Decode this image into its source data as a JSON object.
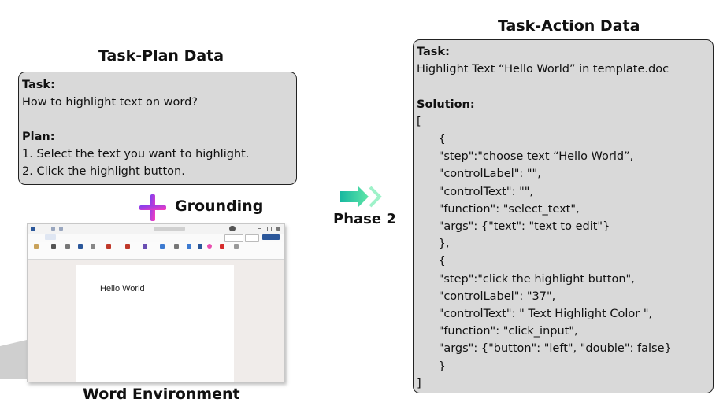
{
  "task_plan": {
    "title": "Task-Plan Data",
    "task_label": "Task:",
    "task_text": "How to highlight text on word?",
    "plan_label": "Plan:",
    "plan_steps": [
      "1. Select the text you want to highlight.",
      "2. Click the highlight button."
    ]
  },
  "grounding": {
    "label": "Grounding"
  },
  "word_env": {
    "caption": "Word Environment",
    "document_text": "Hello World",
    "colors": {
      "ribbon_accent": "#2b579a",
      "canvas": "#f0ecea"
    }
  },
  "phase": {
    "label": "Phase 2",
    "arrow_color": "#2ec4a0"
  },
  "task_action": {
    "title": "Task-Action Data",
    "task_label": "Task:",
    "task_text": "Highlight Text “Hello World” in template.doc",
    "solution_label": "Solution:",
    "solution_lines": [
      "[",
      "      {",
      "      \"step\":\"choose text “Hello World”,",
      "      \"controlLabel\": \"\",",
      "      \"controlText\": \"\",",
      "      \"function\": \"select_text\",",
      "      \"args\": {\"text\": \"text to edit\"}",
      "      },",
      "      {",
      "      \"step\":\"click the highlight button\",",
      "      \"controlLabel\": \"37\",",
      "      \"controlText\": \" Text Highlight Color \",",
      "      \"function\": \"click_input\",",
      "      \"args\": {\"button\": \"left\", \"double\": false}",
      "      }",
      "]"
    ]
  },
  "colors": {
    "box_fill": "#d9d9d9",
    "box_border": "#222222"
  }
}
